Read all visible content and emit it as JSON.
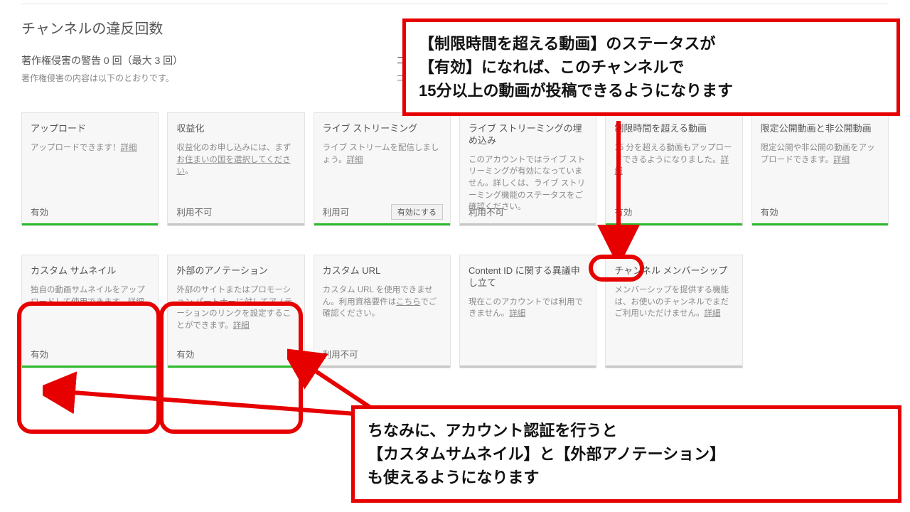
{
  "section_title": "チャンネルの違反回数",
  "copyright": {
    "heading": "著作権侵害の警告 0 回（最大 3 回）",
    "sub": "著作権侵害の内容は以下のとおりです。"
  },
  "community": {
    "heading": "コミュニティ ガ",
    "sub": "コミュニティ ガイド"
  },
  "common": {
    "details": "詳細",
    "details2": "詳細",
    "kochira": "こちら"
  },
  "cards": {
    "r1": [
      {
        "title": "アップロード",
        "desc_a": "アップロードできます！",
        "status": "有効",
        "green": true
      },
      {
        "title": "収益化",
        "desc_a": "収益化のお申し込みには、まず",
        "link": "お住まいの国を選択してください",
        "desc_b": "。",
        "status": "利用不可",
        "green": false
      },
      {
        "title": "ライブ ストリーミング",
        "desc_a": "ライブ ストリームを配信しましょう。",
        "status": "利用可",
        "green": true,
        "enable_btn": "有効にする"
      },
      {
        "title": "ライブ ストリーミングの埋め込み",
        "desc_a": "このアカウントではライブ ストリーミングが有効になっていません。詳しくは、ライブ ストリーミング機能のステータスをご確認ください。",
        "status": "利用不可",
        "green": false,
        "no_details": true
      },
      {
        "title": "制限時間を超える動画",
        "desc_a": "15 分を超える動画もアップロードできるようになりました。",
        "status": "有効",
        "green": true
      },
      {
        "title": "限定公開動画と非公開動画",
        "desc_a": "限定公開や非公開の動画をアップロードできます。",
        "status": "有効",
        "green": true
      }
    ],
    "r2": [
      {
        "title": "カスタム サムネイル",
        "desc_a": "独自の動画サムネイルをアップロードして使用できます。",
        "status": "有効",
        "green": true
      },
      {
        "title": "外部のアノテーション",
        "desc_a": "外部のサイトまたはプロモーション パートナーに対してアノテーションのリンクを設定することができます。",
        "status": "有効",
        "green": true
      },
      {
        "title": "カスタム URL",
        "desc_a": "カスタム URL を使用できません。利用資格要件は",
        "link": "こちら",
        "desc_b": "でご確認ください。",
        "status": "利用不可",
        "green": false,
        "no_details": true
      },
      {
        "title": "Content ID に関する異議申し立て",
        "desc_a": "現在このアカウントでは利用できません。",
        "status": "",
        "green": false,
        "hide_status": true
      },
      {
        "title": "チャンネル メンバーシップ",
        "desc_a": "メンバーシップを提供する機能は、お使いのチャンネルでまだご利用いただけません。",
        "status": "",
        "green": false,
        "hide_status": true
      }
    ]
  },
  "annot": {
    "top": "【制限時間を超える動画】のステータスが\n【有効】になれば、このチャンネルで\n15分以上の動画が投稿できるようになります",
    "bot": "ちなみに、アカウント認証を行うと\n【カスタムサムネイル】と【外部アノテーション】\nも使えるようになります"
  }
}
